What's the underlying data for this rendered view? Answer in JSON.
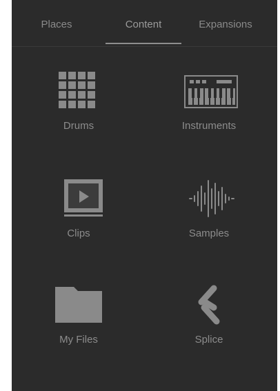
{
  "tabs": [
    {
      "label": "Places"
    },
    {
      "label": "Content",
      "active": true
    },
    {
      "label": "Expansions"
    }
  ],
  "tiles": [
    {
      "label": "Drums",
      "icon": "drum-pads-icon"
    },
    {
      "label": "Instruments",
      "icon": "keyboard-icon"
    },
    {
      "label": "Clips",
      "icon": "clip-play-icon"
    },
    {
      "label": "Samples",
      "icon": "waveform-icon"
    },
    {
      "label": "My Files",
      "icon": "folder-icon"
    },
    {
      "label": "Splice",
      "icon": "splice-logo-icon"
    }
  ],
  "colors": {
    "background": "#2b2b2b",
    "icon": "#8a8a8a",
    "text": "#8c8c8c"
  }
}
